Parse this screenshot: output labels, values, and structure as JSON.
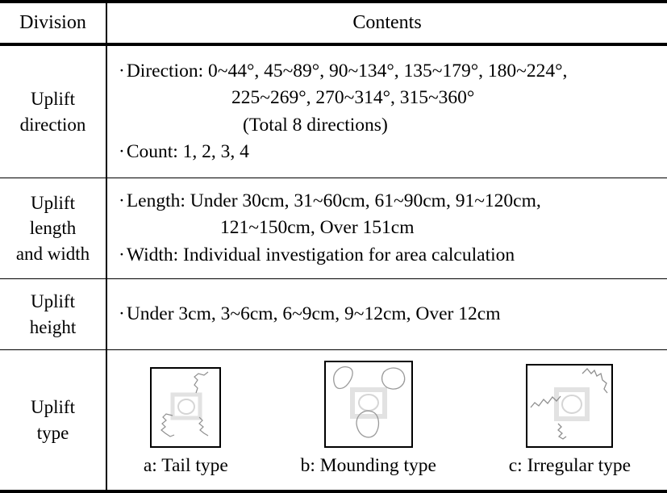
{
  "table": {
    "header": {
      "division": "Division",
      "contents": "Contents"
    },
    "rows": [
      {
        "label_lines": [
          "Uplift",
          "direction"
        ],
        "content_lines": [
          "Direction:  0~44°,  45~89°,  90~134°,  135~179°,  180~224°,",
          "225~269°,  270~314°,  315~360°",
          "(Total 8 directions)",
          "Count:  1, 2, 3, 4"
        ]
      },
      {
        "label_lines": [
          "Uplift",
          "length",
          "and width"
        ],
        "content_lines": [
          "Length:  Under 30cm,  31~60cm,  61~90cm,  91~120cm,",
          "121~150cm,  Over 151cm",
          "Width:  Individual investigation for area calculation"
        ]
      },
      {
        "label_lines": [
          "Uplift",
          "height"
        ],
        "content_lines": [
          "Under 3cm,  3~6cm,  6~9cm,  9~12cm,  Over 12cm"
        ]
      },
      {
        "label_lines": [
          "Uplift",
          "type"
        ],
        "figures": [
          {
            "id": "a",
            "caption": "a: Tail type",
            "icon": "tail-type-diagram"
          },
          {
            "id": "b",
            "caption": "b: Mounding type",
            "icon": "mounding-type-diagram"
          },
          {
            "id": "c",
            "caption": "c: Irregular type",
            "icon": "irregular-type-diagram"
          }
        ]
      }
    ],
    "bullet": "·",
    "colors": {
      "border": "#000000",
      "text": "#000000",
      "background": "#ffffff",
      "diagram_faint": "#d8d8d8",
      "diagram_stroke": "#9a9a9a"
    }
  }
}
